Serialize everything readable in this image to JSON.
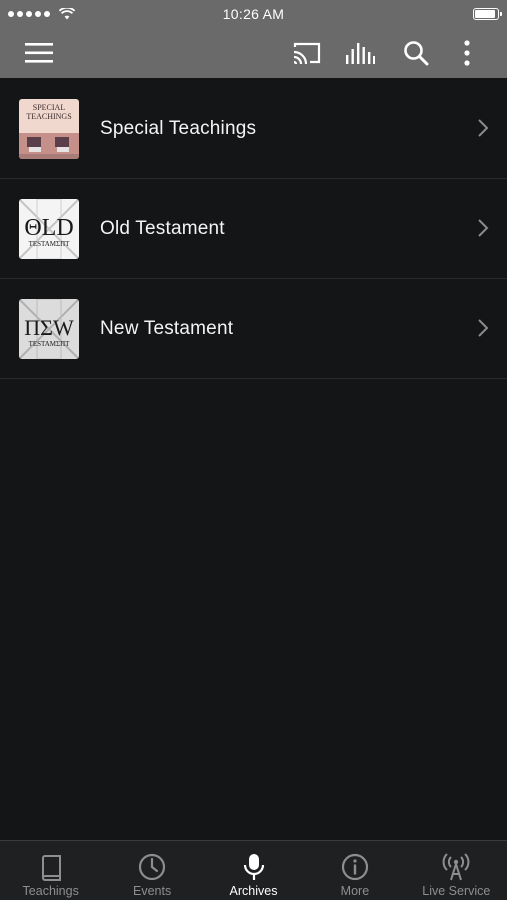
{
  "status_bar": {
    "time": "10:26 AM"
  },
  "app_bar": {
    "icons": [
      "menu-icon",
      "cast-icon",
      "equalizer-icon",
      "search-icon",
      "more-vert-icon"
    ]
  },
  "list": {
    "items": [
      {
        "label": "Special Teachings",
        "thumb_text_1": "SPECIAL",
        "thumb_text_2": "TEACHINGS"
      },
      {
        "label": "Old Testament",
        "thumb_text_1": "ΘLD",
        "thumb_text_2": "TESTAMΣПT"
      },
      {
        "label": "New Testament",
        "thumb_text_1": "ПΣW",
        "thumb_text_2": "TESTAMΣПT"
      }
    ]
  },
  "tab_bar": {
    "tabs": [
      {
        "label": "Teachings",
        "icon": "book-icon",
        "active": false
      },
      {
        "label": "Events",
        "icon": "clock-icon",
        "active": false
      },
      {
        "label": "Archives",
        "icon": "microphone-icon",
        "active": true
      },
      {
        "label": "More",
        "icon": "info-icon",
        "active": false
      },
      {
        "label": "Live Service",
        "icon": "broadcast-icon",
        "active": false
      }
    ]
  },
  "colors": {
    "bar_bg": "#6a6a6a",
    "page_bg": "#141516",
    "tab_bg": "#1f2021",
    "tab_inactive": "#8e8e90",
    "tab_active": "#ffffff"
  }
}
